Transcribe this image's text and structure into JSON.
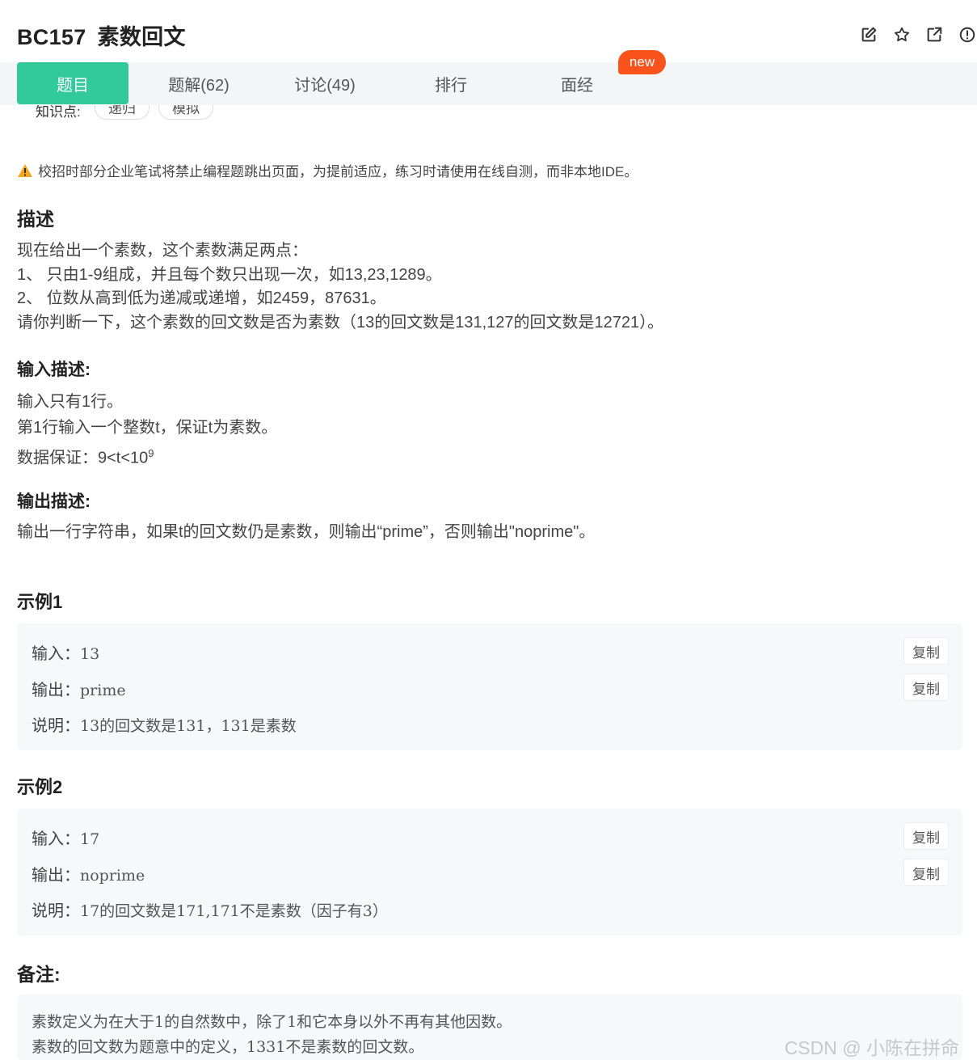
{
  "header": {
    "code": "BC157",
    "title": "素数回文"
  },
  "tabs": [
    {
      "label": "题目",
      "active": true
    },
    {
      "label": "题解(62)",
      "active": false
    },
    {
      "label": "讨论(49)",
      "active": false
    },
    {
      "label": "排行",
      "active": false
    },
    {
      "label": "面经",
      "active": false
    }
  ],
  "badge": {
    "label": "new"
  },
  "knowledge": {
    "label": "知识点:",
    "tags": [
      "递归",
      "模拟"
    ]
  },
  "notice": {
    "text": "校招时部分企业笔试将禁止编程题跳出页面，为提前适应，练习时请使用在线自测，而非本地IDE。"
  },
  "description": {
    "heading": "描述",
    "lines": [
      "现在给出一个素数，这个素数满足两点：",
      "1、   只由1-9组成，并且每个数只出现一次，如13,23,1289。",
      "2、   位数从高到低为递减或递增，如2459，87631。",
      "请你判断一下，这个素数的回文数是否为素数（13的回文数是131,127的回文数是12721）。"
    ]
  },
  "input_desc": {
    "heading": "输入描述:",
    "line1": "输入只有1行。",
    "line2": "第1行输入一个整数t，保证t为素数。",
    "line3_prefix": "数据保证：9<t<10",
    "line3_sup": "9"
  },
  "output_desc": {
    "heading": "输出描述:",
    "line1": "输出一行字符串，如果t的回文数仍是素数，则输出“prime”，否则输出\"noprime\"。"
  },
  "examples": [
    {
      "heading": "示例1",
      "input_label": "输入：",
      "input": "13",
      "output_label": "输出：",
      "output": "prime",
      "explain_label": "说明：",
      "explain": "13的回文数是131，131是素数",
      "copy_label": "复制"
    },
    {
      "heading": "示例2",
      "input_label": "输入：",
      "input": "17",
      "output_label": "输出：",
      "output": "noprime",
      "explain_label": "说明：",
      "explain": "17的回文数是171,171不是素数（因子有3）",
      "copy_label": "复制"
    }
  ],
  "notes": {
    "heading": "备注:",
    "lines": [
      "素数定义为在大于1的自然数中，除了1和它本身以外不再有其他因数。",
      "素数的回文数为题意中的定义，1331不是素数的回文数。"
    ]
  },
  "watermark": "CSDN @ 小陈在拼命",
  "colors": {
    "accent": "#32ca99",
    "badge": "#fa541c",
    "warning": "#f5a623"
  }
}
